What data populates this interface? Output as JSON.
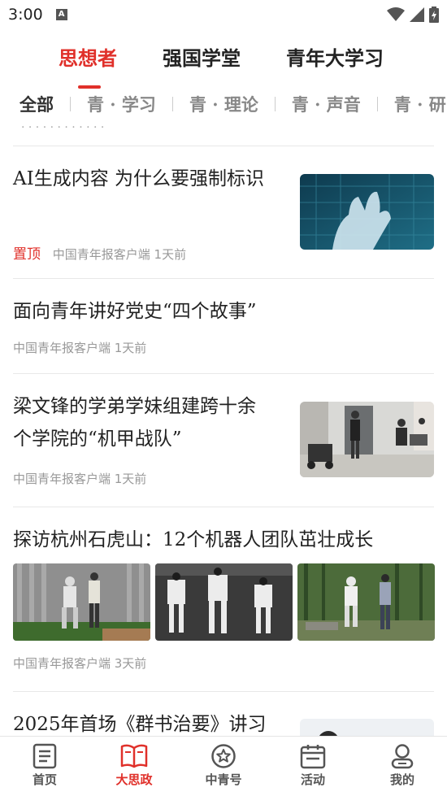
{
  "status": {
    "time": "3:00",
    "notif": "A"
  },
  "top_tabs": [
    {
      "label": "思想者",
      "active": true
    },
    {
      "label": "强国学堂",
      "active": false
    },
    {
      "label": "青年大学习",
      "active": false
    }
  ],
  "sub_tabs": [
    "全部",
    "青 · 学习",
    "青 · 理论",
    "青 · 声音",
    "青 · 研"
  ],
  "feed": {
    "cut_text": "· · · · · · · · · · · ·",
    "items": [
      {
        "title": "AI生成内容 为什么要强制标识",
        "pin": "置顶",
        "source": "中国青年报客户端 1天前"
      },
      {
        "title": "面向青年讲好党史“四个故事”",
        "source": "中国青年报客户端 1天前"
      },
      {
        "title_line1": "梁文锋的学弟学妹组建跨十余",
        "title_line2": "个学院的“机甲战队”",
        "source": "中国青年报客户端 1天前"
      },
      {
        "title": "探访杭州石虎山：12个机器人团队茁壮成长",
        "source": "中国青年报客户端 3天前"
      },
      {
        "title": "2025年首场《群书治要》讲习"
      }
    ]
  },
  "bottom_nav": [
    {
      "label": "首页",
      "icon": "document-icon"
    },
    {
      "label": "大思政",
      "icon": "open-book-icon",
      "active": true
    },
    {
      "label": "中青号",
      "icon": "star-badge-icon"
    },
    {
      "label": "活动",
      "icon": "calendar-icon"
    },
    {
      "label": "我的",
      "icon": "person-icon"
    }
  ],
  "colors": {
    "accent": "#e0302a",
    "text": "#222222",
    "muted": "#999999"
  }
}
